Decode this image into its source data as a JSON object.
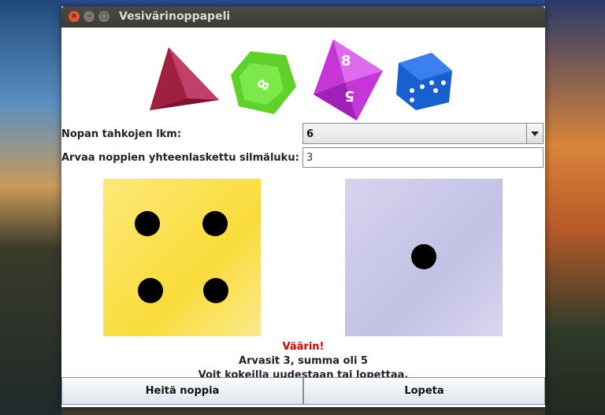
{
  "window": {
    "title": "Vesivärinoppapeli"
  },
  "titlebar_buttons": {
    "close": "×",
    "minimize": "–",
    "maximize": "□"
  },
  "dice_images": [
    {
      "name": "d4",
      "color": "#a02040",
      "label": ""
    },
    {
      "name": "d12",
      "color": "#5fd12a",
      "label": "8"
    },
    {
      "name": "d8",
      "color": "#c437d6",
      "label": "8"
    },
    {
      "name": "d6",
      "color": "#1a5fd0",
      "label": ""
    }
  ],
  "form": {
    "faces_label": "Nopan tahkojen lkm:",
    "faces_value": "6",
    "guess_label": "Arvaa noppien yhteenlaskettu silmäluku:",
    "guess_value": "3"
  },
  "dice_results": [
    {
      "value": 4,
      "color": "#fbe66a"
    },
    {
      "value": 1,
      "color": "#cfcde8"
    }
  ],
  "result": {
    "status": "Väärin!",
    "status_color": "#d40000",
    "detail": "Arvasit 3, summa oli 5",
    "hint": "Voit kokeilla uudestaan tai lopettaa."
  },
  "buttons": {
    "roll": "Heitä noppia",
    "quit": "Lopeta"
  }
}
